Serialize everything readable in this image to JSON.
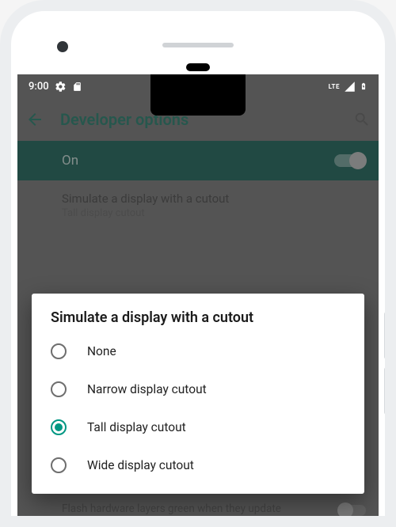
{
  "status": {
    "time": "9:00",
    "lte_label": "LTE"
  },
  "app_bar": {
    "title": "Developer options"
  },
  "master_switch": {
    "label": "On",
    "enabled": true
  },
  "preference": {
    "title": "Simulate a display with a cutout",
    "summary": "Tall display cutout"
  },
  "dialog": {
    "title": "Simulate a display with a cutout",
    "options": [
      {
        "label": "None",
        "selected": false
      },
      {
        "label": "Narrow display cutout",
        "selected": false
      },
      {
        "label": "Tall display cutout",
        "selected": true
      },
      {
        "label": "Wide display cutout",
        "selected": false
      }
    ]
  },
  "peek": {
    "text": "Flash hardware layers green when they update"
  },
  "colors": {
    "teal": "#0c7963",
    "accent": "#009783",
    "switch_bg": "#00594c"
  }
}
